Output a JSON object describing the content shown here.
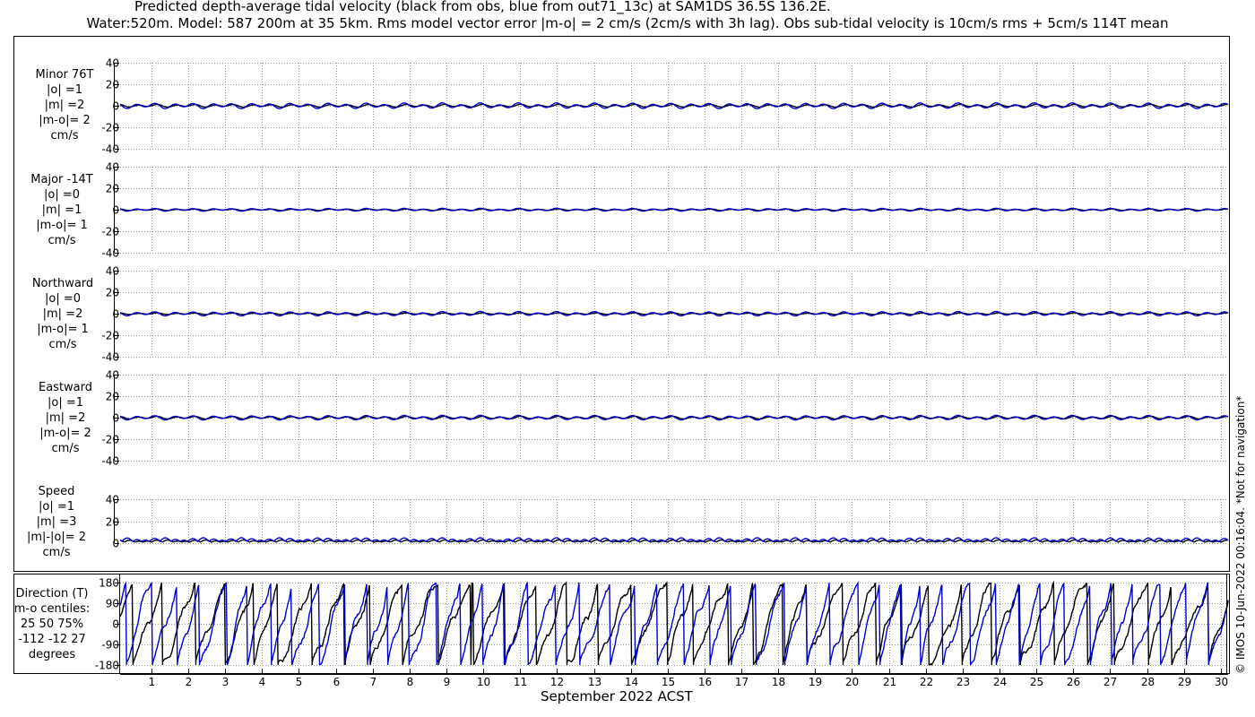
{
  "title_line1": "Predicted depth-average tidal velocity (black from obs, blue from out71_13c) at SAM1DS 36.5S 136.2E.",
  "title_line2": "Water:520m. Model: 587 200m at 35 5km. Rms model vector error |m-o| = 2 cm/s (2cm/s with 3h lag). Obs sub-tidal velocity is 10cm/s rms + 5cm/s 114T mean",
  "footer": "© IMOS 10-Jun-2022 00:16:04. *Not for navigation*",
  "colors": {
    "obs": "#000000",
    "model": "#0000cc",
    "grid": "#9a9a9a"
  },
  "chart_data": {
    "type": "line",
    "xlabel": "September 2022 ACST",
    "x_ticks": [
      1,
      2,
      3,
      4,
      5,
      6,
      7,
      8,
      9,
      10,
      11,
      12,
      13,
      14,
      15,
      16,
      17,
      18,
      19,
      20,
      21,
      22,
      23,
      24,
      25,
      26,
      27,
      28,
      29,
      30
    ],
    "xlim": [
      0.15,
      30.2
    ],
    "grid": true,
    "series_legend": {
      "obs": "black from obs",
      "model": "blue from out71_13c"
    },
    "panels": [
      {
        "id": "minor",
        "label_lines": [
          "Minor 76T",
          "|o| =1",
          "|m| =2",
          "|m-o|= 2",
          "cm/s"
        ],
        "ylim": [
          -40,
          40
        ],
        "yticks": [
          "40",
          "20",
          "0",
          "-20",
          "-40"
        ],
        "obs_amp": 1,
        "model_amp": 2
      },
      {
        "id": "major",
        "label_lines": [
          "Major -14T",
          "|o| =0",
          "|m| =1",
          "|m-o|= 1",
          "cm/s"
        ],
        "ylim": [
          -40,
          40
        ],
        "yticks": [
          "40",
          "20",
          "0",
          "-20",
          "-40"
        ],
        "obs_amp": 0.6,
        "model_amp": 1
      },
      {
        "id": "north",
        "label_lines": [
          "Northward",
          "|o| =0",
          "|m| =2",
          "|m-o|= 1",
          "cm/s"
        ],
        "ylim": [
          -40,
          40
        ],
        "yticks": [
          "40",
          "20",
          "0",
          "-20",
          "-40"
        ],
        "obs_amp": 0.6,
        "model_amp": 1.5
      },
      {
        "id": "east",
        "label_lines": [
          "Eastward",
          "|o| =1",
          "|m| =2",
          "|m-o|= 2",
          "cm/s"
        ],
        "ylim": [
          -40,
          40
        ],
        "yticks": [
          "40",
          "20",
          "0",
          "-20",
          "-40"
        ],
        "obs_amp": 1,
        "model_amp": 1.6
      },
      {
        "id": "speed",
        "label_lines": [
          "Speed",
          "|o| =1",
          "|m| =3",
          "|m|-|o|= 2",
          "cm/s"
        ],
        "ylim": [
          0,
          40
        ],
        "yticks": [
          "40",
          "20",
          "0"
        ],
        "obs_amp": 1.5,
        "model_amp": 2.5
      },
      {
        "id": "direction",
        "label_lines": [
          "Direction (T)",
          "m-o centiles:",
          "25  50  75%",
          "-112  -12   27",
          "degrees"
        ],
        "ylim": [
          -180,
          180
        ],
        "yticks": [
          "180",
          "90",
          "0",
          "-90",
          "-180"
        ]
      }
    ]
  }
}
